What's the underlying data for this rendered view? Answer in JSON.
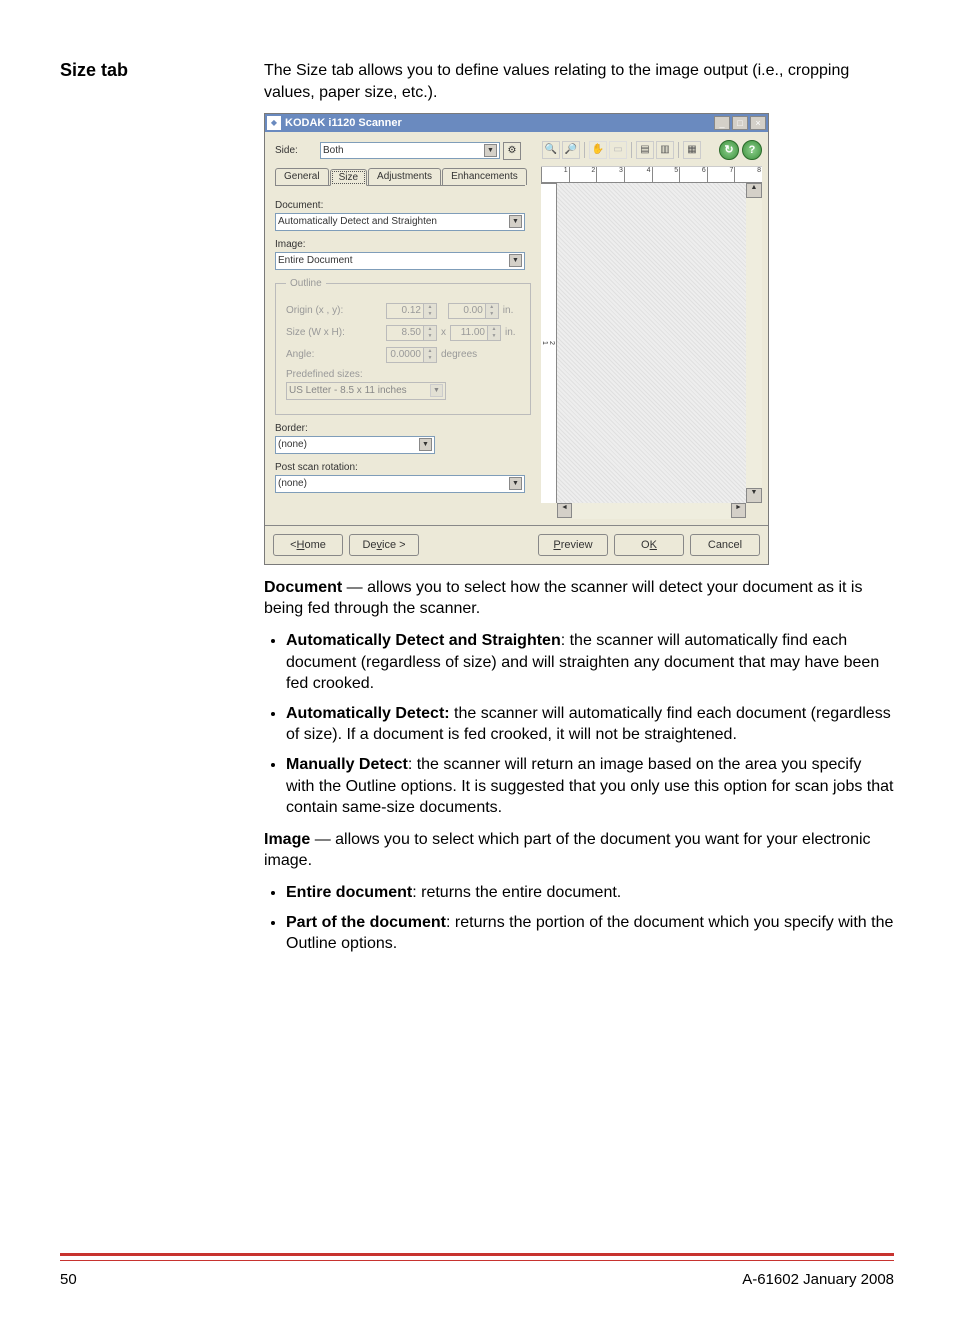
{
  "heading": "Size tab",
  "intro": "The Size tab allows you to define values relating to the image output (i.e., cropping values, paper size, etc.).",
  "dialog": {
    "title": "KODAK i1120 Scanner",
    "sideLabel": "Side:",
    "sideValue": "Both",
    "tabs": {
      "general": "General",
      "size": "Size",
      "adjustments": "Adjustments",
      "enhancements": "Enhancements"
    },
    "documentLabel": "Document:",
    "documentValue": "Automatically Detect and Straighten",
    "imageLabel": "Image:",
    "imageValue": "Entire Document",
    "outline": {
      "legend": "Outline",
      "originLabel": "Origin (x , y):",
      "originX": "0.12",
      "originY": "0.00",
      "originUnit": "in.",
      "sizeLabel": "Size (W x H):",
      "sizeW": "8.50",
      "sizeH": "11.00",
      "sizeUnit": "in.",
      "times": "x",
      "angleLabel": "Angle:",
      "angleValue": "0.0000",
      "angleUnit": "degrees",
      "predefLabel": "Predefined sizes:",
      "predefValue": "US Letter - 8.5 x 11 inches"
    },
    "borderLabel": "Border:",
    "borderValue": "(none)",
    "postRotLabel": "Post scan rotation:",
    "postRotValue": "(none)",
    "buttons": {
      "home": "< Home",
      "device": "Device >",
      "preview": "Preview",
      "ok": "OK",
      "cancel": "Cancel"
    }
  },
  "body": {
    "documentIntro1": "Document",
    "documentIntro2": " — allows you to select how the scanner will detect your document as it is being fed through the scanner.",
    "b1t": "Automatically Detect and Straighten",
    "b1": ": the scanner will automatically find each document (regardless of size) and will straighten any document that may have been fed crooked.",
    "b2t": "Automatically Detect:",
    "b2": " the scanner will automatically find each document (regardless of size). If a document is fed crooked, it will not be straightened.",
    "b3t": "Manually Detect",
    "b3": ": the scanner will return an image based on the area you specify with the Outline options. It is suggested that you only use this option for scan jobs that contain same-size documents.",
    "imageIntro1": "Image",
    "imageIntro2": " — allows you to select which part of the document you want for your electronic image.",
    "b4t": "Entire document",
    "b4": ": returns the entire document.",
    "b5t": "Part of the document",
    "b5": ": returns the portion of the document which you specify with the Outline options."
  },
  "footer": {
    "page": "50",
    "doc": "A-61602  January 2008"
  }
}
